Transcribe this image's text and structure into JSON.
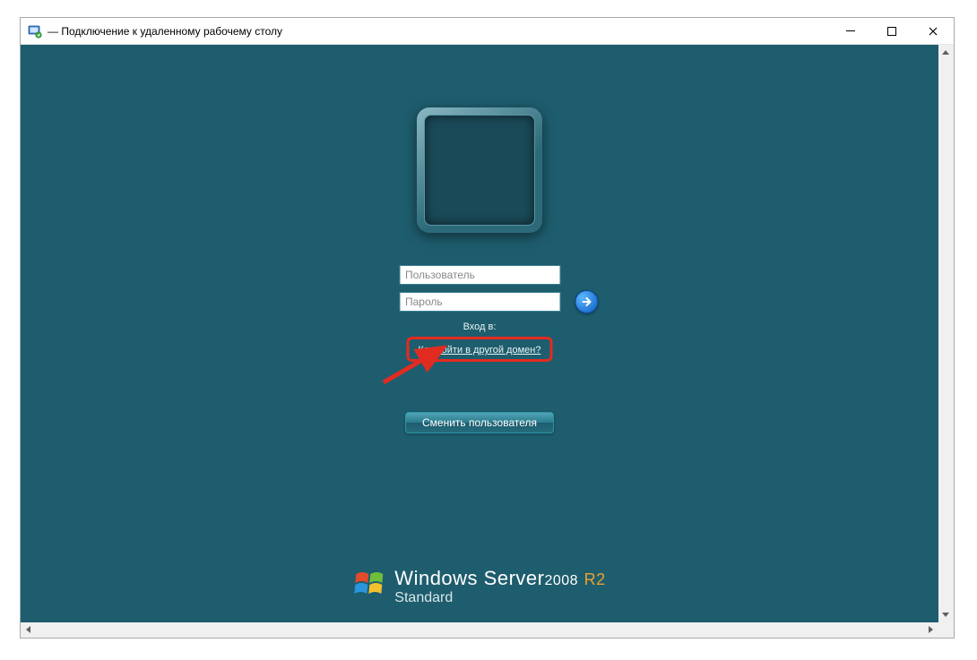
{
  "window": {
    "title": "— Подключение к удаленному рабочему столу"
  },
  "login": {
    "username_placeholder": "Пользователь",
    "password_placeholder": "Пароль",
    "domain_label": "Вход в:",
    "domain_link": "Как войти в другой домен?",
    "switch_user_label": "Сменить пользователя"
  },
  "branding": {
    "product": "Windows Server",
    "year": "2008",
    "release": "R2",
    "edition": "Standard"
  }
}
